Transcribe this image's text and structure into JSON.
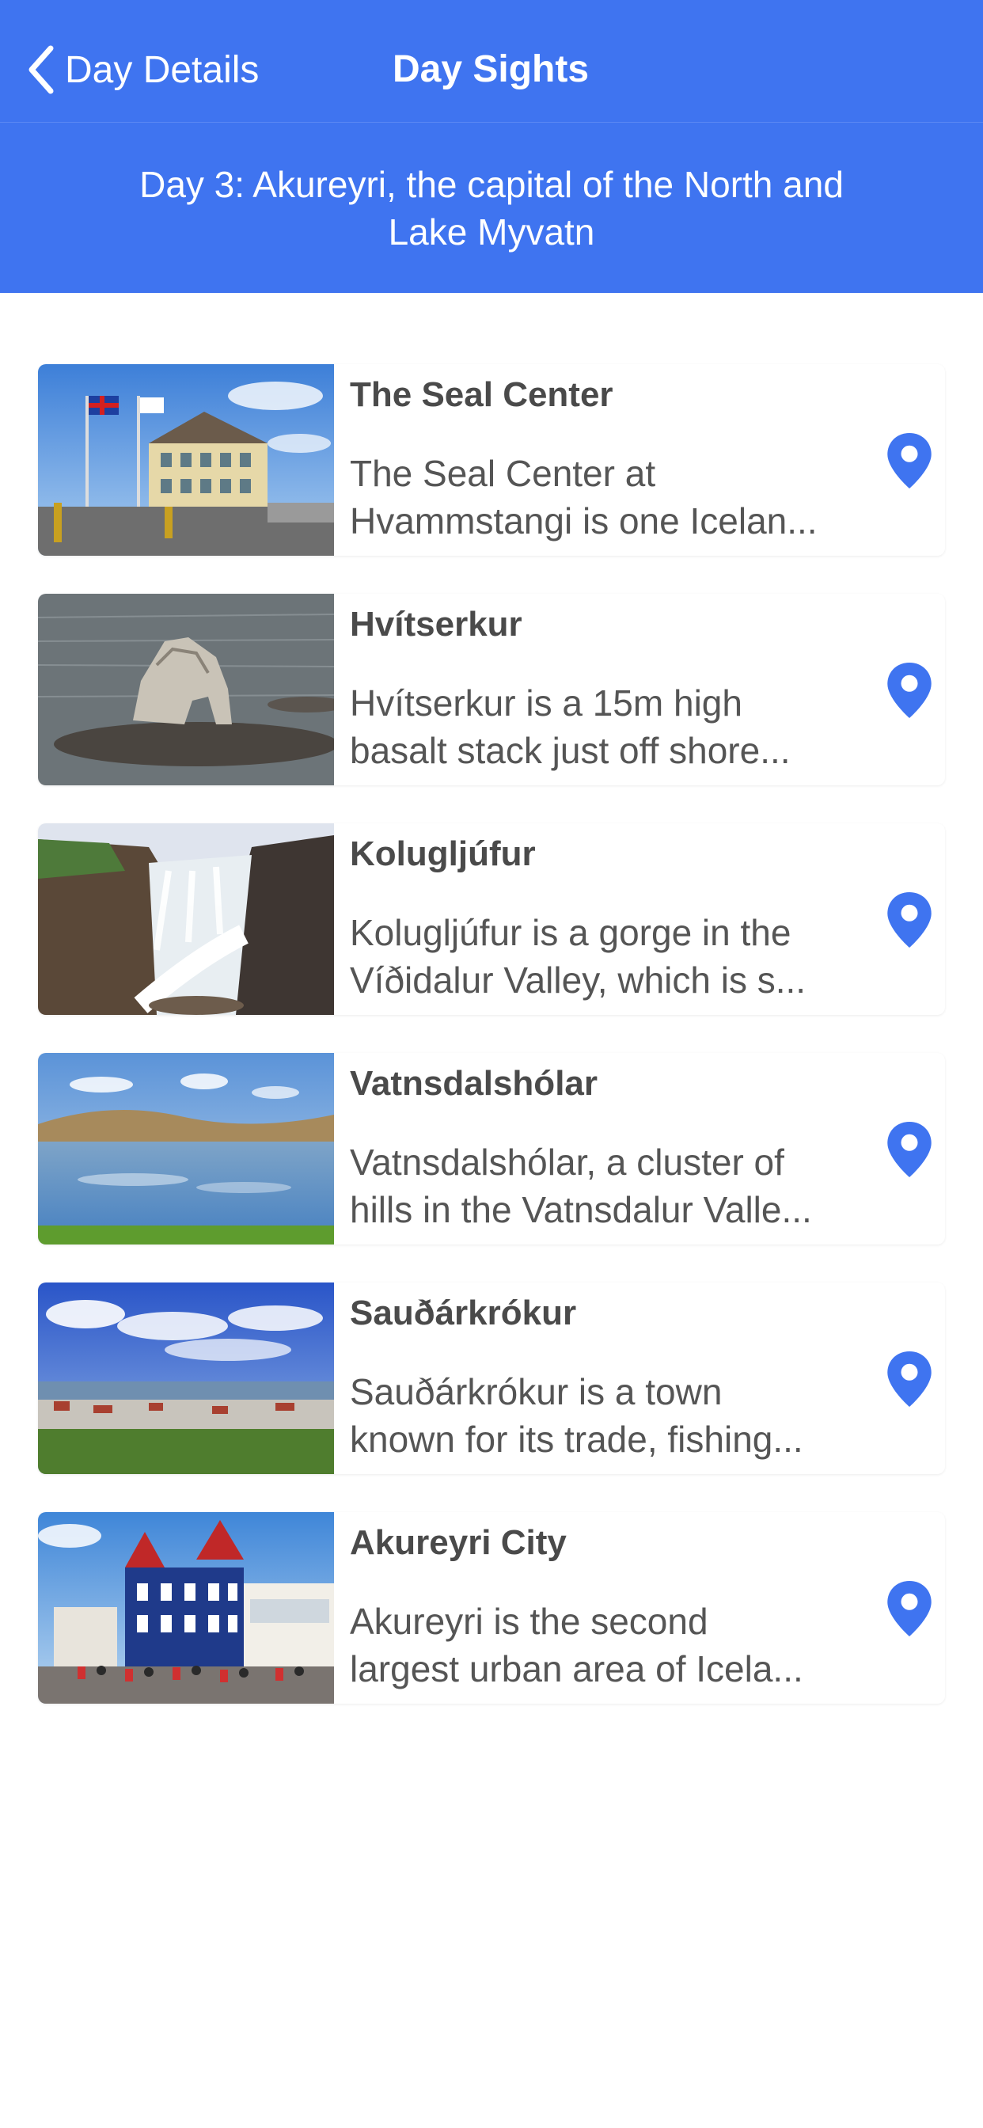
{
  "nav": {
    "back_label": "Day Details",
    "title": "Day Sights"
  },
  "day_header": {
    "line1": "Day 3: Akureyri, the capital of the North and",
    "line2": "Lake Myvatn"
  },
  "colors": {
    "accent": "#3f74f0",
    "pin": "#3f74f0"
  },
  "sights": [
    {
      "name": "The Seal Center",
      "desc_line1": "The Seal Center at",
      "desc_line2": "Hvammstangi is one Icelan...",
      "pin_icon": "map-pin-icon"
    },
    {
      "name": "Hvítserkur",
      "desc_line1": "Hvítserkur is a 15m high",
      "desc_line2": "basalt stack just off shore...",
      "pin_icon": "map-pin-icon"
    },
    {
      "name": "Kolugljúfur",
      "desc_line1": "Kolugljúfur is a gorge in the",
      "desc_line2": "Víðidalur Valley, which is s...",
      "pin_icon": "map-pin-icon"
    },
    {
      "name": "Vatnsdalshólar",
      "desc_line1": "Vatnsdalshólar, a cluster of",
      "desc_line2": "hills in the Vatnsdalur Valle...",
      "pin_icon": "map-pin-icon"
    },
    {
      "name": "Sauðárkrókur",
      "desc_line1": "Sauðárkrókur is a town",
      "desc_line2": "known for its trade, fishing...",
      "pin_icon": "map-pin-icon"
    },
    {
      "name": "Akureyri City",
      "desc_line1": "Akureyri is the second",
      "desc_line2": "largest urban area of Icela...",
      "pin_icon": "map-pin-icon"
    }
  ]
}
